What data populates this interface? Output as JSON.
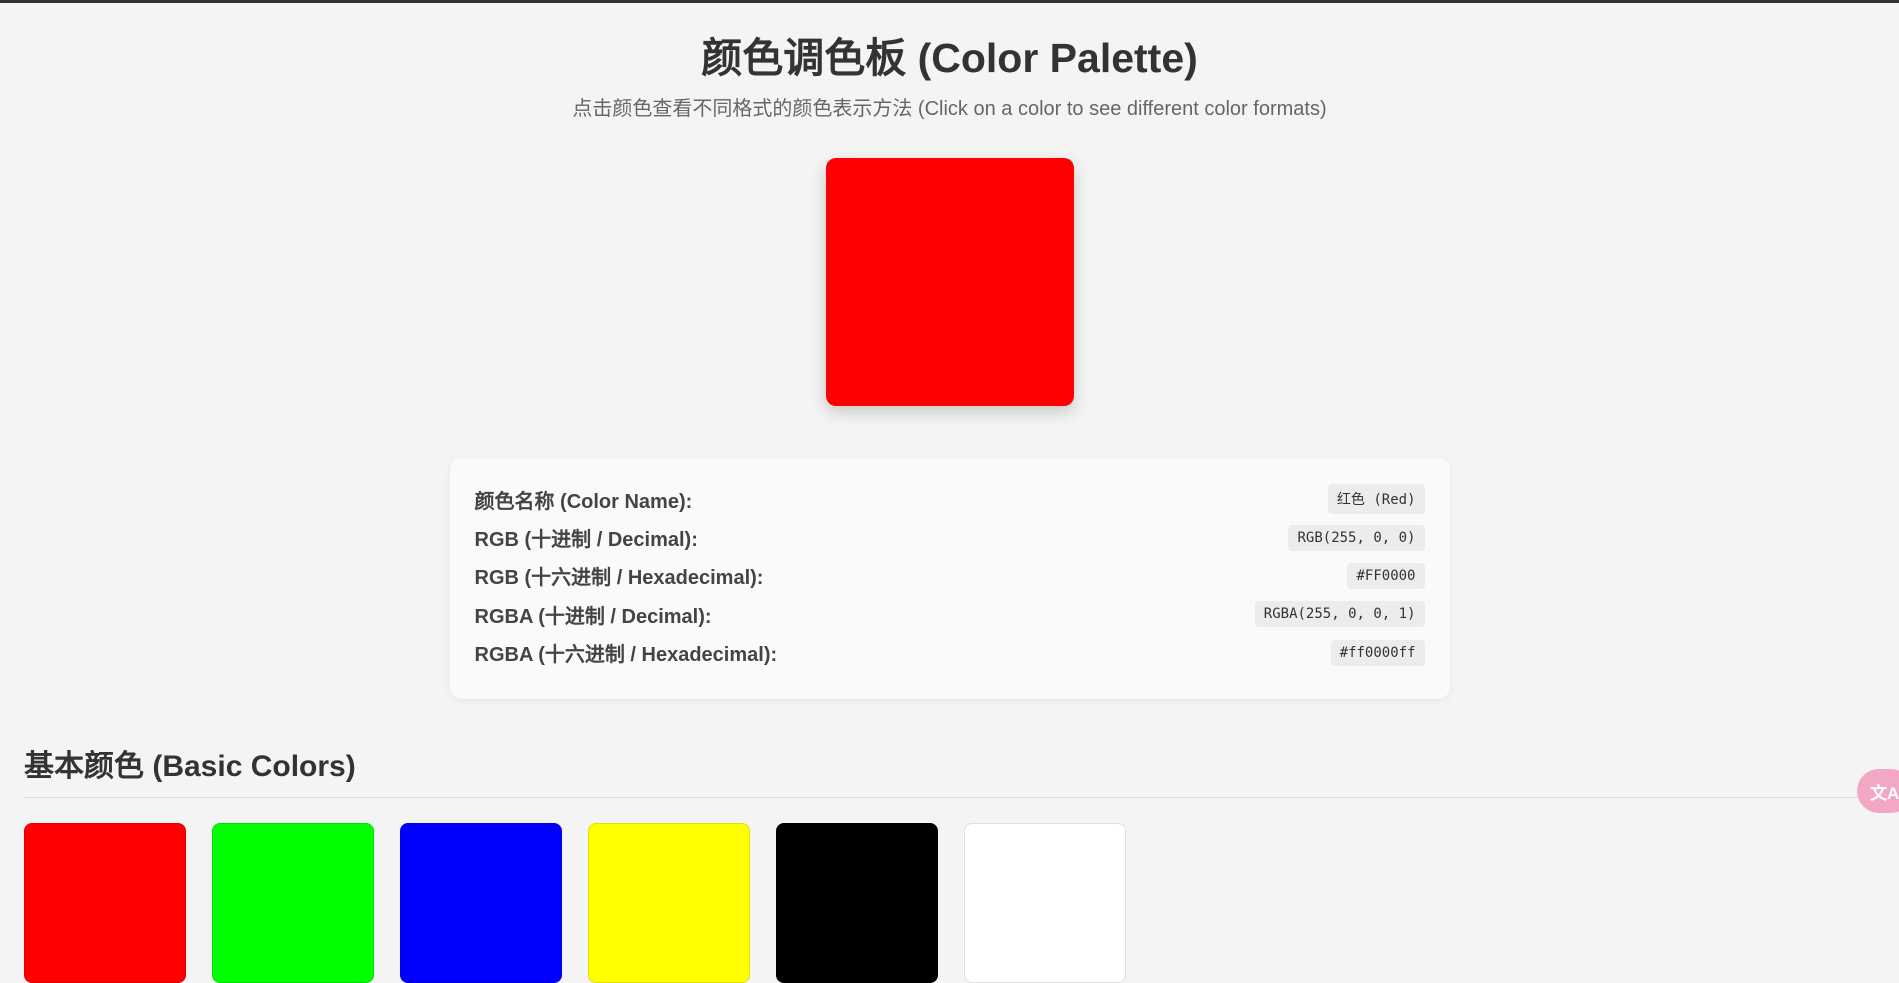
{
  "header": {
    "title": "颜色调色板 (Color Palette)",
    "subtitle": "点击颜色查看不同格式的颜色表示方法 (Click on a color to see different color formats)"
  },
  "preview": {
    "color": "#FF0000"
  },
  "info": {
    "rows": [
      {
        "label": "颜色名称 (Color Name):",
        "value": "红色 (Red)"
      },
      {
        "label": "RGB (十进制 / Decimal):",
        "value": "RGB(255, 0, 0)"
      },
      {
        "label": "RGB (十六进制 / Hexadecimal):",
        "value": "#FF0000"
      },
      {
        "label": "RGBA (十进制 / Decimal):",
        "value": "RGBA(255, 0, 0, 1)"
      },
      {
        "label": "RGBA (十六进制 / Hexadecimal):",
        "value": "#ff0000ff"
      }
    ]
  },
  "basic_colors": {
    "title": "基本颜色 (Basic Colors)",
    "swatches": [
      {
        "color": "#FF0000"
      },
      {
        "color": "#00FF00"
      },
      {
        "color": "#0000FF"
      },
      {
        "color": "#FFFF00"
      },
      {
        "color": "#000000"
      },
      {
        "color": "#FFFFFF"
      }
    ]
  },
  "translate_widget": {
    "icon": "translate-icon",
    "glyph": "文A",
    "color": "#f2a8c4"
  }
}
